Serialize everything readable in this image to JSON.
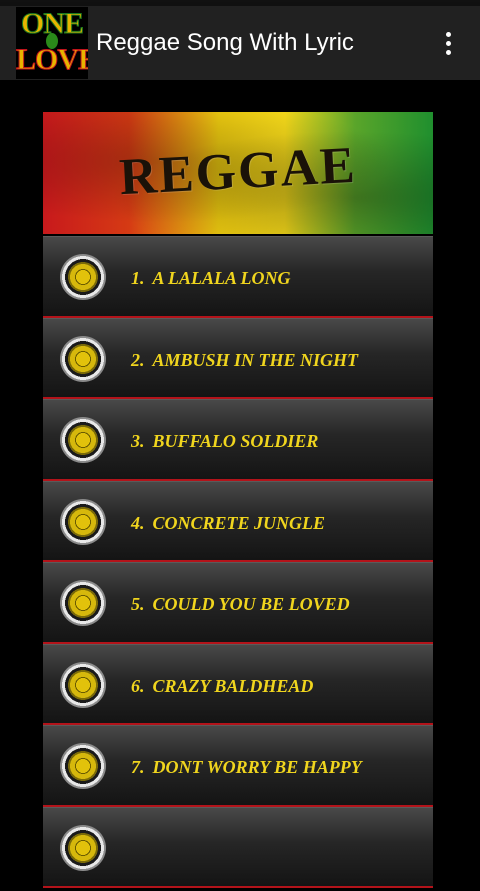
{
  "app": {
    "title": "Reggae Song With Lyric",
    "logo_line1": "ONE",
    "logo_line2": "LOVE"
  },
  "banner": {
    "text": "REGGAE"
  },
  "colors": {
    "song_text": "#f0d51e",
    "divider": "#b3131a",
    "appbar": "#212121"
  },
  "icons": {
    "menu": "more-vert-icon",
    "song": "speaker-icon"
  },
  "songs": [
    {
      "num": "1.",
      "title": "A LALALA LONG"
    },
    {
      "num": "2.",
      "title": "AMBUSH IN THE NIGHT"
    },
    {
      "num": "3.",
      "title": "BUFFALO SOLDIER"
    },
    {
      "num": "4.",
      "title": "CONCRETE JUNGLE"
    },
    {
      "num": "5.",
      "title": "COULD YOU BE LOVED"
    },
    {
      "num": "6.",
      "title": "CRAZY BALDHEAD"
    },
    {
      "num": "7.",
      "title": "DONT WORRY BE HAPPY"
    },
    {
      "num": "",
      "title": ""
    }
  ]
}
